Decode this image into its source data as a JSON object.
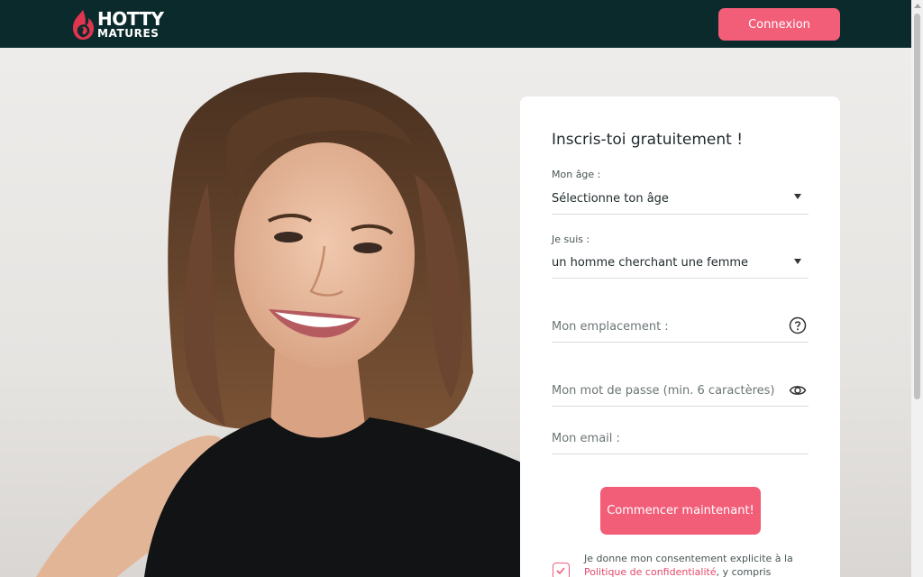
{
  "header": {
    "logo_top": "HOTTY",
    "logo_bottom": "MATURES",
    "login_label": "Connexion"
  },
  "form": {
    "title": "Inscris-toi gratuitement !",
    "age_label": "Mon âge :",
    "age_value": "Sélectionne ton âge",
    "gender_label": "Je suis :",
    "gender_value": "un homme cherchant une femme",
    "location_placeholder": "Mon emplacement :",
    "password_placeholder": "Mon mot de passe (min. 6 caractères)",
    "email_placeholder": "Mon email :",
    "submit_label": "Commencer maintenant!",
    "consent_text_before": "Je donne mon consentement explicite à la ",
    "consent_link": "Politique de confidentialité",
    "consent_text_after": ", y compris l'utilisation"
  },
  "icons": {
    "logo": "flame-icon",
    "age_caret": "caret-down-icon",
    "gender_caret": "caret-down-icon",
    "location_help": "question-circle-icon",
    "password_toggle": "eye-icon",
    "consent": "checkbox-icon"
  },
  "colors": {
    "header_bg": "#0b2a2c",
    "accent": "#f25d78",
    "link": "#e4486a"
  }
}
